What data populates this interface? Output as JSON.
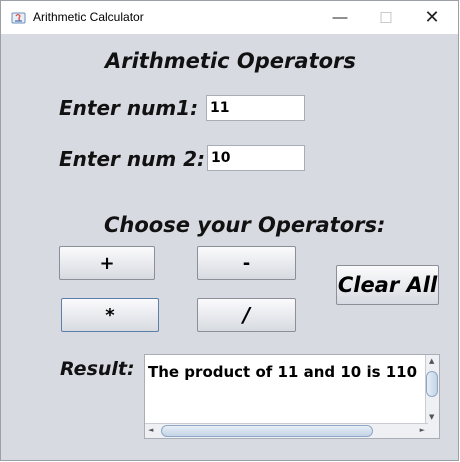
{
  "window": {
    "title": "Arithmetic Calculator"
  },
  "icons": {
    "app": "java-app-icon",
    "minimize": "minimize-icon",
    "maximize": "maximize-icon",
    "close": "close-icon"
  },
  "controls": {
    "minimize": "—",
    "maximize": "☐",
    "close": "✕"
  },
  "main": {
    "heading": "Arithmetic Operators",
    "num1_label": "Enter num1:",
    "num1_value": "11",
    "num2_label": "Enter num 2:",
    "num2_value": "10",
    "operators_heading": "Choose your Operators:",
    "buttons": {
      "plus": "+",
      "minus": "-",
      "times": "*",
      "divide": "/",
      "clear": "Clear All"
    },
    "result_label": "Result:",
    "result_text": "The product of 11 and 10 is 110"
  },
  "scroll": {
    "up": "▲",
    "down": "▼",
    "left": "◄",
    "right": "►"
  }
}
